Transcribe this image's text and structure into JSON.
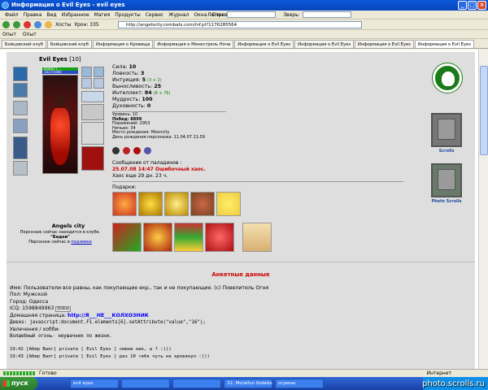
{
  "window": {
    "title": "Информация о Evil Eyes - evil eyes"
  },
  "menu": [
    "Файл",
    "Правка",
    "Вид",
    "Избранное",
    "Магия",
    "Продукты",
    "Сервис",
    "Журнал",
    "Окна",
    "Справка"
  ],
  "login": {
    "login_label": "Логин:",
    "pass_label": "Зверь:"
  },
  "toolbar": {
    "hosts": "Хосты",
    "uron": "Урон: 335",
    "address": "http://angelscity.combats.com/inf.pl?1176285564"
  },
  "toolbar2": {
    "item1": "Опыт",
    "item2": "Опыт"
  },
  "tabs": [
    "Бойцовский клуб",
    "Бойцовский клуб",
    "Информация о Кровища",
    "Информация о Менестрель Ночи",
    "Информация о Evil Eyes",
    "Информация о Evil Eyes",
    "Информация о Evil Eyes",
    "Информация о Evil Eyes"
  ],
  "character": {
    "name": "Evil Eyes",
    "level": "[10]",
    "hp": "858/977",
    "mp": "1617/1660",
    "city": "Angels city",
    "loc1": "Персонаж сейчас находится в клубе.",
    "loc2": "\"Бедни\"",
    "loc3": "Персонаж сейчас в ",
    "loc3_link": "подземке"
  },
  "stats": {
    "str_label": "Сила:",
    "str": "10",
    "agi_label": "Ловкость:",
    "agi": "3",
    "int_label": "Интуиция:",
    "int": "5",
    "int_bonus": "(3 + 2)",
    "end_label": "Выносливость:",
    "end": "25",
    "intel_label": "Интеллект:",
    "intel": "84",
    "intel_bonus": "(8 + 76)",
    "wis_label": "Мудрость:",
    "wis": "100",
    "spi_label": "Духовность:",
    "spi": "0"
  },
  "info": {
    "level": "Уровень: 10",
    "wins": "Побед: 8899",
    "losses": "Поражений: 2953",
    "draws": "Ничьих: 34",
    "birthplace": "Место рождения: Mooncity",
    "birthday": "День рождения персонажа: 11.04.07 21:59"
  },
  "paladin": {
    "label": "Сообщение от паладинов :",
    "date": "25.07.08 14:47 Ошибочный хаос.",
    "chaos": "Хаос еще 29 дн. 23 ч."
  },
  "gifts": {
    "label": "Подарки:"
  },
  "emblem": {
    "scrolls": "Scrolls",
    "photo": "Photo Scrolls"
  },
  "anketa": {
    "title": "Анкетные данные",
    "name": "Имя: Пользователи все равны, как покупающие екр., так и не покупающие. (c) Повелитель Огня",
    "sex": "Пол: Мужской",
    "city": "Город: Одесса",
    "icq": "ICQ: 1598849963",
    "icq_status": "Online",
    "home_label": "Домашняя страница: ",
    "home": "http://Я___НЕ___КОЛХОЗНИК",
    "about": "Девиз: javascript:document.F1.elements[6].setAttribute(\"value\",\"16\");",
    "hobby": "Увлечения / хобби:",
    "hobby_text": "Волшебный огонь- неушачник по жизни.",
    "chat1": "19:42 [Абир Валг] private [ Evil Eyes ] смени ник, а ? :)))",
    "chat2": "19:43 [Абир Валг] private [ Evil Eyes ] раз 10 тебя чуть не кровянул :)))"
  },
  "status": {
    "text": "Готово",
    "zone": "Интернет"
  },
  "taskbar": {
    "start": "пуск",
    "tasks": [
      "evil eyes",
      "",
      "",
      "32. Мо/alfun Kodeks",
      "огрины"
    ]
  },
  "watermark": "photo.scrolls.ru"
}
